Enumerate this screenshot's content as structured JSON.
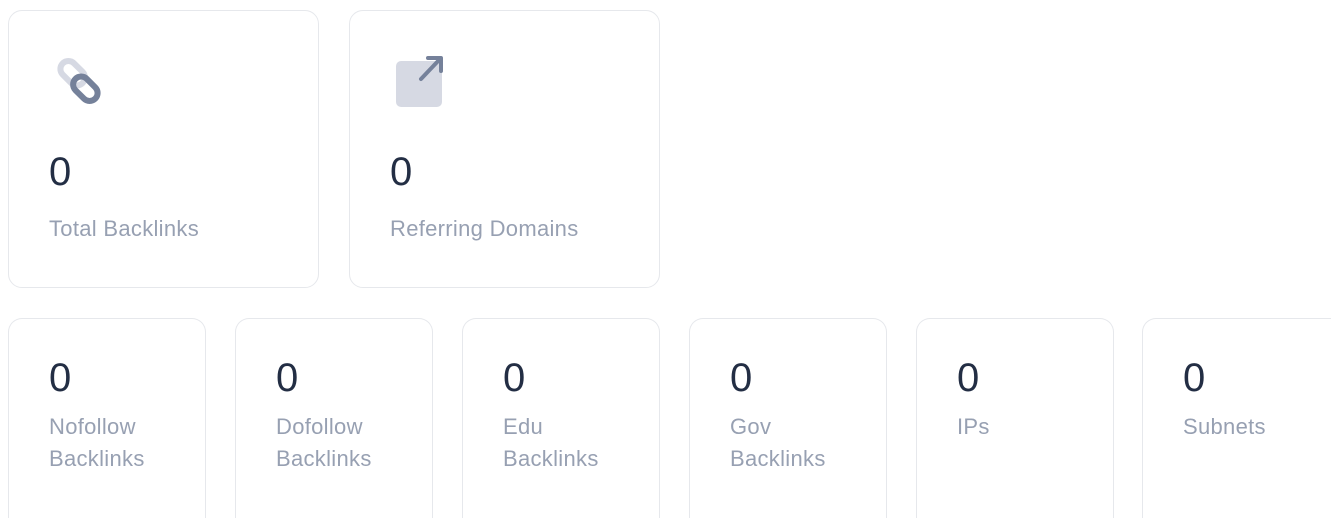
{
  "colors": {
    "value_text": "#232e44",
    "label_text": "#97a0b2",
    "icon_dark": "#75819a",
    "icon_light": "#d6d9e3",
    "card_border": "#e6e8ec"
  },
  "primary_stats": [
    {
      "value": "0",
      "label": "Total Backlinks",
      "icon": "link-icon"
    },
    {
      "value": "0",
      "label": "Referring Domains",
      "icon": "external-link-icon"
    }
  ],
  "secondary_stats": [
    {
      "value": "0",
      "label": "Nofollow Backlinks"
    },
    {
      "value": "0",
      "label": "Dofollow Backlinks"
    },
    {
      "value": "0",
      "label": "Edu Backlinks"
    },
    {
      "value": "0",
      "label": "Gov Backlinks"
    },
    {
      "value": "0",
      "label": "IPs"
    },
    {
      "value": "0",
      "label": "Subnets"
    }
  ]
}
